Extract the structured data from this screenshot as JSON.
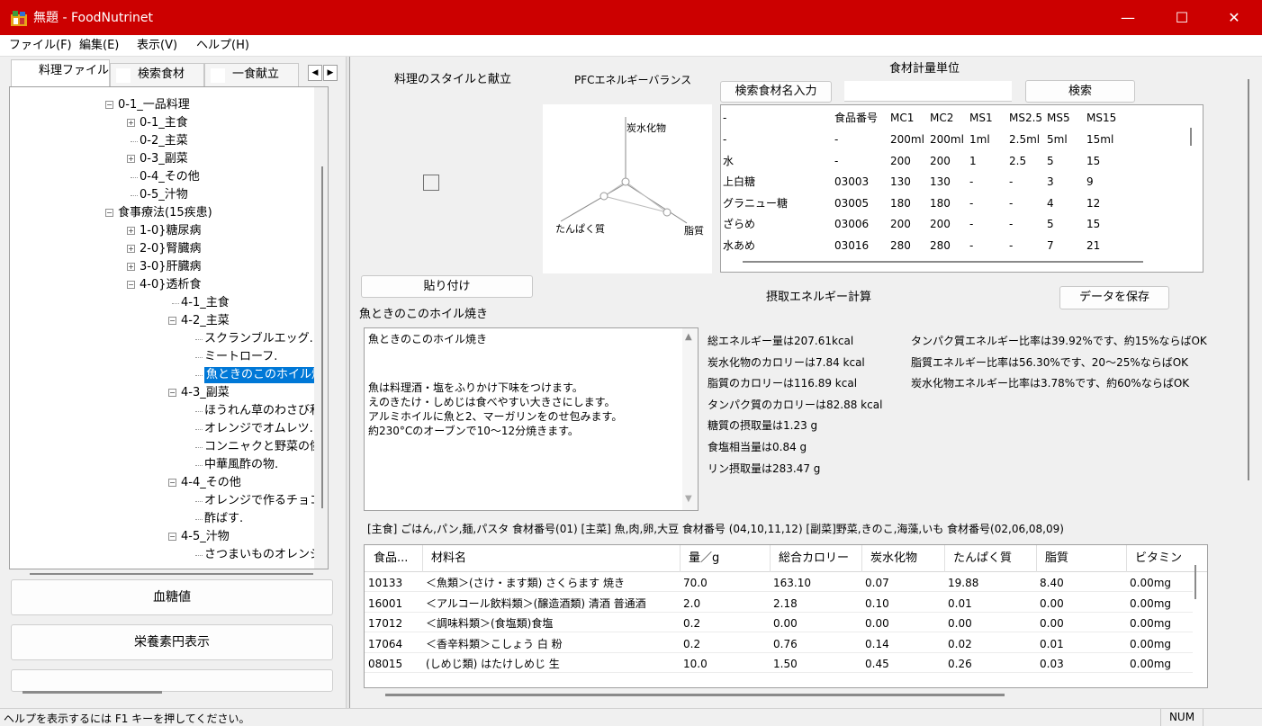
{
  "window": {
    "title": "無題 - FoodNutrinet",
    "minimize": "—",
    "maximize": "☐",
    "close": "✕"
  },
  "menu": [
    "ファイル(F)",
    "編集(E)",
    "表示(V)",
    "ヘルプ(H)"
  ],
  "tabs": [
    "料理ファイル",
    "検索食材",
    "一食献立"
  ],
  "tree": [
    {
      "label": "0-1_一品料理",
      "depth": 0,
      "box": "−"
    },
    {
      "label": "0-1_主食",
      "depth": 1,
      "box": "+"
    },
    {
      "label": "0-2_主菜",
      "depth": 1,
      "box": ""
    },
    {
      "label": "0-3_副菜",
      "depth": 1,
      "box": "+"
    },
    {
      "label": "0-4_その他",
      "depth": 1,
      "box": ""
    },
    {
      "label": "0-5_汁物",
      "depth": 1,
      "box": ""
    },
    {
      "label": "食事療法(15疾患)",
      "depth": 0,
      "box": "−"
    },
    {
      "label": "1-0}糖尿病",
      "depth": 1,
      "box": "+"
    },
    {
      "label": "2-0}腎臓病",
      "depth": 1,
      "box": "+"
    },
    {
      "label": "3-0}肝臓病",
      "depth": 1,
      "box": "+"
    },
    {
      "label": "4-0}透析食",
      "depth": 1,
      "box": "−"
    },
    {
      "label": "4-1_主食",
      "depth": 2,
      "box": ""
    },
    {
      "label": "4-2_主菜",
      "depth": 2,
      "box": "−"
    },
    {
      "label": "スクランブルエッグ.",
      "depth": 3,
      "box": ""
    },
    {
      "label": "ミートローフ.",
      "depth": 3,
      "box": ""
    },
    {
      "label": "魚ときのこのホイル焼",
      "depth": 3,
      "box": "",
      "selected": true
    },
    {
      "label": "4-3_副菜",
      "depth": 2,
      "box": "−"
    },
    {
      "label": "ほうれん草のわさび和",
      "depth": 3,
      "box": ""
    },
    {
      "label": "オレンジでオムレツ.",
      "depth": 3,
      "box": ""
    },
    {
      "label": "コンニャクと野菜の傑",
      "depth": 3,
      "box": ""
    },
    {
      "label": "中華風酢の物.",
      "depth": 3,
      "box": ""
    },
    {
      "label": "4-4_その他",
      "depth": 2,
      "box": "−"
    },
    {
      "label": "オレンジで作るチョコ:",
      "depth": 3,
      "box": ""
    },
    {
      "label": "酢ばす.",
      "depth": 3,
      "box": ""
    },
    {
      "label": "4-5_汁物",
      "depth": 2,
      "box": "−"
    },
    {
      "label": "さつまいものオレンジ:",
      "depth": 3,
      "box": ""
    }
  ],
  "left_buttons": [
    "血糖値",
    "栄養素円表示"
  ],
  "dish": {
    "style_label": "料理のスタイルと献立",
    "paste_button": "貼り付け",
    "name": "魚ときのこのホイル焼き",
    "recipe_lines": [
      "魚ときのこのホイル焼き",
      "",
      "魚は料理酒・塩をふりかけ下味をつけます。",
      "えのきたけ・しめじは食べやすい大きさにします。",
      "アルミホイルに魚と2、マーガリンをのせ包みます。",
      "約230°Cのオーブンで10〜12分焼きます。"
    ]
  },
  "pfc": {
    "title": "PFCエネルギーバランス",
    "carb": "炭水化物",
    "protein": "たんぱく質",
    "fat": "脂質"
  },
  "units": {
    "title": "食材計量単位",
    "search_label": "検索食材名入力",
    "search_value": "",
    "search_button": "検索",
    "headers": [
      "-",
      "食品番号",
      "MC1",
      "MC2",
      "MS1",
      "MS2.5",
      "MS5",
      "MS15"
    ],
    "rows": [
      [
        "-",
        "-",
        "200ml",
        "200ml",
        "1ml",
        "2.5ml",
        "5ml",
        "15ml"
      ],
      [
        "水",
        "-",
        "200",
        "200",
        "1",
        "2.5",
        "5",
        "15"
      ],
      [
        "上白糖",
        "03003",
        "130",
        "130",
        "-",
        "-",
        "3",
        "9"
      ],
      [
        "グラニュー糖",
        "03005",
        "180",
        "180",
        "-",
        "-",
        "4",
        "12"
      ],
      [
        "ざらめ",
        "03006",
        "200",
        "200",
        "-",
        "-",
        "5",
        "15"
      ],
      [
        "水あめ",
        "03016",
        "280",
        "280",
        "-",
        "-",
        "7",
        "21"
      ]
    ]
  },
  "energy": {
    "title": "摂取エネルギー計算",
    "save_button": "データを保存",
    "left": [
      "総エネルギー量は207.61kcal",
      "炭水化物のカロリーは7.84 kcal",
      "脂質のカロリーは116.89 kcal",
      "タンパク質のカロリーは82.88 kcal",
      "糖質の摂取量は1.23 g",
      "食塩相当量は0.84 g",
      "リン摂取量は283.47 g"
    ],
    "right": [
      "タンパク質エネルギー比率は39.92%です、約15%ならばOK",
      "脂質エネルギー比率は56.30%です、20〜25%ならばOK",
      "炭水化物エネルギー比率は3.78%です、約60%ならばOK"
    ]
  },
  "category_note": "[主食] ごはん,パン,麺,パスタ 食材番号(01)  [主菜] 魚,肉,卵,大豆  食材番号 (04,10,11,12)  [副菜]野菜,きのこ,海藻,いも 食材番号(02,06,08,09)",
  "ingredients": {
    "headers": [
      "食品...",
      "材料名",
      "量／g",
      "総合カロリー",
      "炭水化物",
      "たんぱく質",
      "脂質",
      "ビタミン"
    ],
    "rows": [
      [
        "10133",
        "＜魚類＞(さけ・ます類) さくらます 焼き",
        "70.0",
        "163.10",
        "0.07",
        "19.88",
        "8.40",
        "0.00mg"
      ],
      [
        "16001",
        "＜アルコール飲料類＞(醸造酒類) 清酒 普通酒",
        "2.0",
        "2.18",
        "0.10",
        "0.01",
        "0.00",
        "0.00mg"
      ],
      [
        "17012",
        "＜調味料類＞(食塩類)食塩",
        "0.2",
        "0.00",
        "0.00",
        "0.00",
        "0.00",
        "0.00mg"
      ],
      [
        "17064",
        "＜香辛料類＞こしょう 白 粉",
        "0.2",
        "0.76",
        "0.14",
        "0.02",
        "0.01",
        "0.00mg"
      ],
      [
        "08015",
        "(しめじ類) はたけしめじ 生",
        "10.0",
        "1.50",
        "0.45",
        "0.26",
        "0.03",
        "0.00mg"
      ]
    ]
  },
  "status": {
    "help": "ヘルプを表示するには F1 キーを押してください。",
    "num": "NUM"
  }
}
